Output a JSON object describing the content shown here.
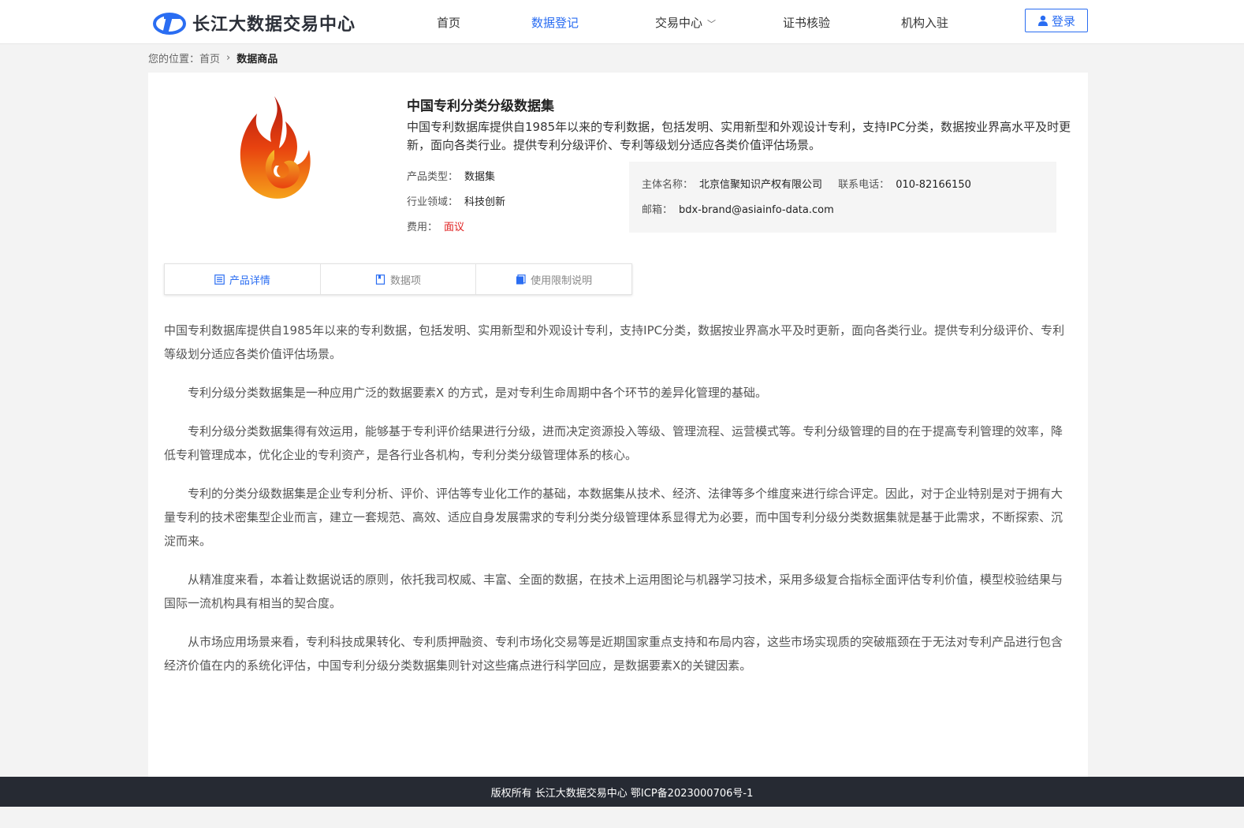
{
  "site": {
    "name": "长江大数据交易中心",
    "brand_color": "#2a6df2"
  },
  "nav": {
    "items": [
      {
        "label": "首页"
      },
      {
        "label": "数据登记"
      },
      {
        "label": "交易中心"
      },
      {
        "label": "证书核验"
      },
      {
        "label": "机构入驻"
      }
    ],
    "login_label": "登录"
  },
  "breadcrumb": {
    "prefix": "您的位置：",
    "home": "首页",
    "current": "数据商品"
  },
  "product": {
    "title": "中国专利分类分级数据集",
    "summary": "中国专利数据库提供自1985年以来的专利数据，包括发明、实用新型和外观设计专利，支持IPC分类，数据按业界高水平及时更新，面向各类行业。提供专利分级评价、专利等级划分适应各类价值评估场景。",
    "type_label": "产品类型：",
    "type_value": "数据集",
    "domain_label": "行业领域：",
    "domain_value": "科技创新",
    "fee_label": "费用：",
    "fee_value": "面议",
    "contact": {
      "entity_label": "主体名称：",
      "entity_value": "北京信聚知识产权有限公司",
      "phone_label": "联系电话：",
      "phone_value": "010-82166150",
      "email_label": "邮箱：",
      "email_value": "bdx-brand@asiainfo-data.com"
    }
  },
  "tabs": [
    {
      "label": "产品详情",
      "icon": "list-icon"
    },
    {
      "label": "数据项",
      "icon": "bookmark-icon"
    },
    {
      "label": "使用限制说明",
      "icon": "document-icon"
    }
  ],
  "content": {
    "paragraphs": [
      "中国专利数据库提供自1985年以来的专利数据，包括发明、实用新型和外观设计专利，支持IPC分类，数据按业界高水平及时更新，面向各类行业。提供专利分级评价、专利等级划分适应各类价值评估场景。",
      "专利分级分类数据集是一种应用广泛的数据要素X 的方式，是对专利生命周期中各个环节的差异化管理的基础。",
      "专利分级分类数据集得有效运用，能够基于专利评价结果进行分级，进而决定资源投入等级、管理流程、运营模式等。专利分级管理的目的在于提高专利管理的效率，降低专利管理成本，优化企业的专利资产，是各行业各机构，专利分类分级管理体系的核心。",
      "专利的分类分级数据集是企业专利分析、评价、评估等专业化工作的基础，本数据集从技术、经济、法律等多个维度来进行综合评定。因此，对于企业特别是对于拥有大量专利的技术密集型企业而言，建立一套规范、高效、适应自身发展需求的专利分类分级管理体系显得尤为必要，而中国专利分级分类数据集就是基于此需求，不断探索、沉淀而来。",
      " 从精准度来看，本着让数据说话的原则，依托我司权威、丰富、全面的数据，在技术上运用图论与机器学习技术，采用多级复合指标全面评估专利价值，模型校验结果与国际一流机构具有相当的契合度。",
      " 从市场应用场景来看，专利科技成果转化、专利质押融资、专利市场化交易等是近期国家重点支持和布局内容，这些市场实现质的突破瓶颈在于无法对专利产品进行包含经济价值在内的系统化评估，中国专利分级分类数据集则针对这些痛点进行科学回应，是数据要素X的关键因素。"
    ]
  },
  "footer": {
    "text": "版权所有 长江大数据交易中心 鄂ICP备2023000706号-1"
  }
}
